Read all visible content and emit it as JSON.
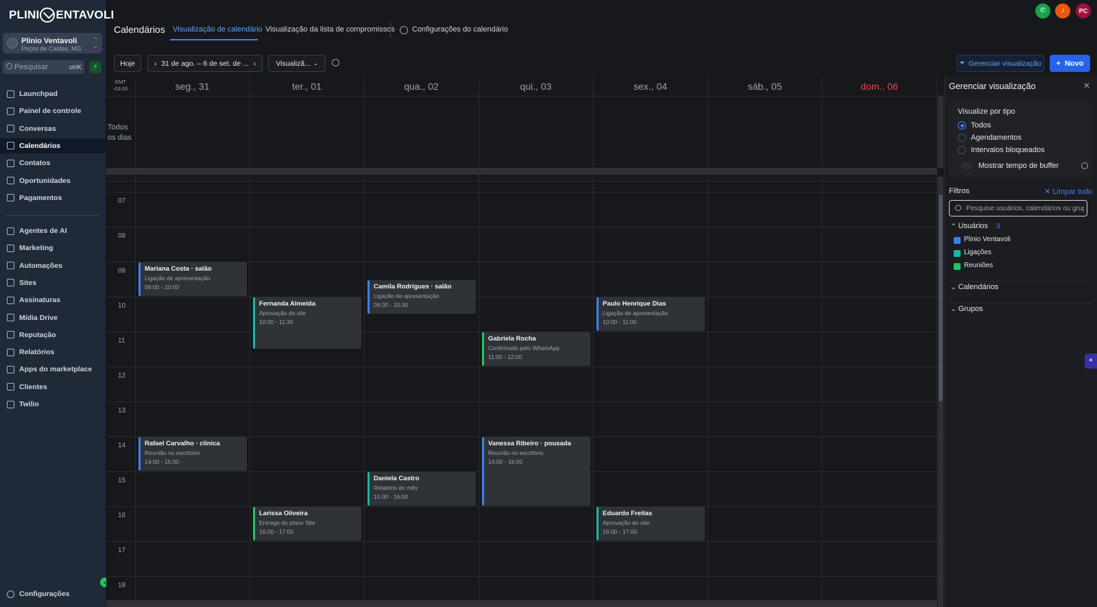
{
  "brand": {
    "logo_left": "PLINI",
    "logo_right": "ENTAVOLI"
  },
  "account": {
    "name": "Plinio Ventavoli",
    "location": "Poços de Caldas, MG"
  },
  "search": {
    "placeholder": "Pesquisar",
    "shortcut": "ctrlK"
  },
  "sidebar": {
    "items": [
      {
        "label": "Launchpad",
        "icon": "rocket-icon"
      },
      {
        "label": "Painel de controle",
        "icon": "grid-icon"
      },
      {
        "label": "Conversas",
        "icon": "chat-icon"
      },
      {
        "label": "Calendários",
        "icon": "calendar-icon",
        "active": true
      },
      {
        "label": "Contatos",
        "icon": "contacts-icon"
      },
      {
        "label": "Oportunidades",
        "icon": "opportunities-icon"
      },
      {
        "label": "Pagamentos",
        "icon": "payments-icon"
      }
    ],
    "items2": [
      {
        "label": "Agentes de AI",
        "icon": "ai-icon"
      },
      {
        "label": "Marketing",
        "icon": "send-icon"
      },
      {
        "label": "Automações",
        "icon": "automation-icon"
      },
      {
        "label": "Sites",
        "icon": "sites-icon"
      },
      {
        "label": "Assinaturas",
        "icon": "membership-icon"
      },
      {
        "label": "Mídia Drive",
        "icon": "media-icon"
      },
      {
        "label": "Reputação",
        "icon": "star-icon"
      },
      {
        "label": "Relatórios",
        "icon": "chart-icon"
      },
      {
        "label": "Apps do marketplace",
        "icon": "apps-icon"
      },
      {
        "label": "Clientes",
        "icon": "user-icon"
      },
      {
        "label": "Twilio",
        "icon": "twilio-icon"
      }
    ],
    "settings": "Configurações"
  },
  "header": {
    "title": "Calendários",
    "tabs": [
      "Visualização de calendário",
      "Visualização da lista de compromissos"
    ],
    "settings_tab": "Configurações do calendário",
    "avatar": "PC"
  },
  "toolbar": {
    "today": "Hoje",
    "range": "31 de ago. – 6 de set. de ...",
    "view": "Visualizã...",
    "manage": "Gerenciar visualização",
    "new": "Novo"
  },
  "calendar": {
    "timezone": [
      "GMT",
      "-03:00"
    ],
    "allday": [
      "Todos",
      "os dias"
    ],
    "days": [
      "seg., 31",
      "ter., 01",
      "qua., 02",
      "qui., 03",
      "sex., 04",
      "sáb., 05",
      "dom., 06"
    ],
    "hours": [
      "07",
      "08",
      "09",
      "10",
      "11",
      "12",
      "13",
      "14",
      "15",
      "16",
      "17",
      "18"
    ],
    "events": [
      {
        "day": 0,
        "start": 9,
        "end": 10,
        "title": "Mariana Costa · salão",
        "sub": "Ligação de apresentação",
        "time": "09:00 - 10:00",
        "color": "blue"
      },
      {
        "day": 1,
        "start": 10,
        "end": 11.5,
        "title": "Fernanda Almeida",
        "sub": "Aprovação do site",
        "time": "10:00 - 11:30",
        "color": "teal"
      },
      {
        "day": 2,
        "start": 9.5,
        "end": 10.5,
        "title": "Camila Rodrigues · salão",
        "sub": "Ligação de apresentação",
        "time": "09:30 - 10:30",
        "color": "blue"
      },
      {
        "day": 3,
        "start": 11,
        "end": 12,
        "title": "Gabriela Rocha",
        "sub": "Confirmado pelo WhatsApp",
        "time": "11:00 - 12:00",
        "color": "green"
      },
      {
        "day": 4,
        "start": 10,
        "end": 11,
        "title": "Paulo Henrique Dias",
        "sub": "Ligação de apresentação",
        "time": "10:00 - 11:00",
        "color": "blue"
      },
      {
        "day": 0,
        "start": 14,
        "end": 15,
        "title": "Rafael Carvalho · clínica",
        "sub": "Reunião no escritório",
        "time": "14:00 - 15:00",
        "color": "blue"
      },
      {
        "day": 3,
        "start": 14,
        "end": 16,
        "title": "Vanessa Ribeiro · pousada",
        "sub": "Reunião no escritório",
        "time": "14:00 - 16:00",
        "color": "blue"
      },
      {
        "day": 2,
        "start": 15,
        "end": 16,
        "title": "Daniela Castro",
        "sub": "Relatório do mês",
        "time": "15:00 - 16:00",
        "color": "teal"
      },
      {
        "day": 1,
        "start": 16,
        "end": 17,
        "title": "Larissa Oliveira",
        "sub": "Entrega do plano Site",
        "time": "16:00 - 17:00",
        "color": "green"
      },
      {
        "day": 4,
        "start": 16,
        "end": 17,
        "title": "Eduardo Freitas",
        "sub": "Aprovação do site",
        "time": "16:00 - 17:00",
        "color": "teal"
      }
    ]
  },
  "panel": {
    "title": "Gerenciar visualização",
    "by_type": "Visualize por tipo",
    "types": [
      "Todos",
      "Agendamentos",
      "Intervalos bloqueados"
    ],
    "buffer": "Mostrar tempo de buffer",
    "filters": "Filtros",
    "clear": "Limpar tudo",
    "search_placeholder": "Pesquise usuários, calendários ou grupos",
    "users_label": "Usuários",
    "users_count": "3",
    "users": [
      {
        "name": "Plinio Ventavoli",
        "color": "#3b82f6"
      },
      {
        "name": "Ligações",
        "color": "#14b8a6"
      },
      {
        "name": "Reuniões",
        "color": "#22c55e"
      }
    ],
    "calendars_label": "Calendários",
    "groups_label": "Grupos"
  }
}
